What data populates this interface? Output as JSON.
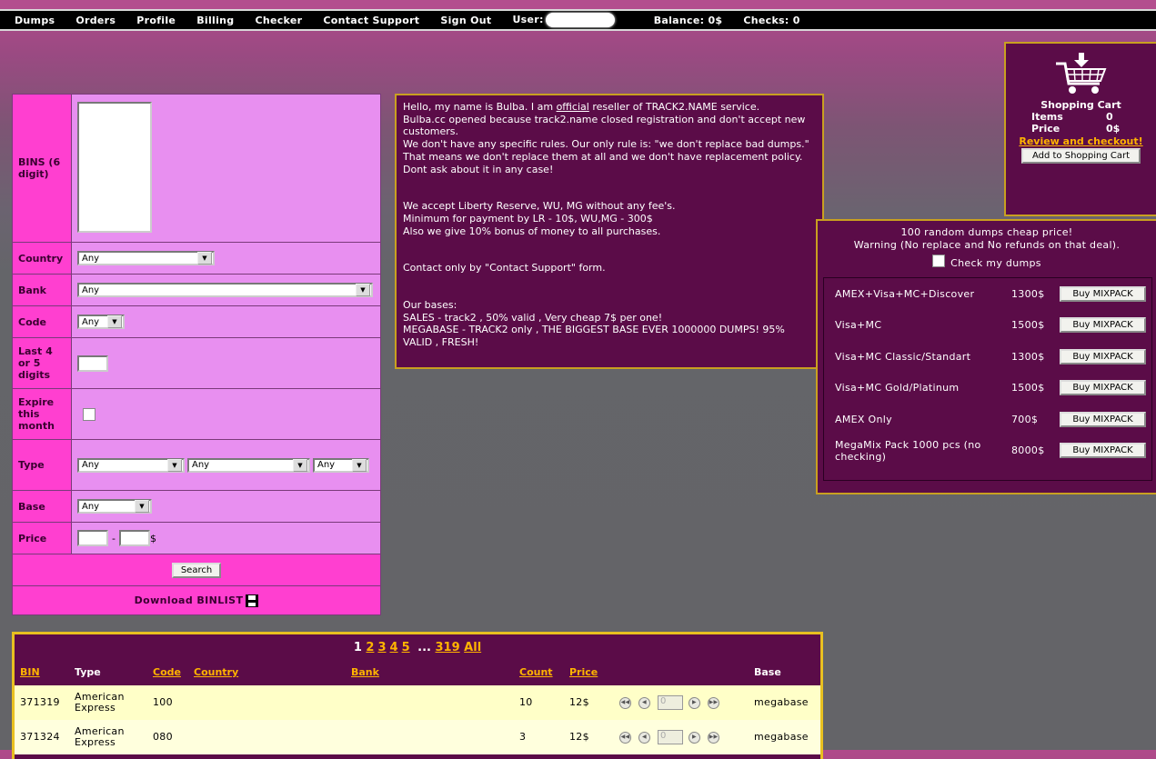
{
  "nav": {
    "dumps": "Dumps",
    "orders": "Orders",
    "profile": "Profile",
    "billing": "Billing",
    "checker": "Checker",
    "contact": "Contact Support",
    "signout": "Sign Out",
    "user_label": "User:",
    "balance": "Balance: 0$",
    "checks": "Checks: 0"
  },
  "search": {
    "bins_label": "BINS (6 digit)",
    "country_label": "Country",
    "country_value": "Any",
    "bank_label": "Bank",
    "bank_value": "Any",
    "code_label": "Code",
    "code_value": "Any",
    "last4_label": "Last 4 or 5 digits",
    "expire_label": "Expire this month",
    "type_label": "Type",
    "type_value1": "Any",
    "type_value2": "Any",
    "type_value3": "Any",
    "base_label": "Base",
    "base_value": "Any",
    "price_label": "Price",
    "price_sep": "-",
    "price_unit": "$",
    "search_button": "Search",
    "download": "Download BINLIST"
  },
  "info": {
    "p1_pre": "Hello, my name is Bulba. I am ",
    "p1_official": "official",
    "p1_post": " reseller of TRACK2.NAME service.\nBulba.cc opened because track2.name closed registration and don't accept new customers.\nWe don't have any specific rules. Our only rule is: \"we don't replace bad dumps.\"\nThat means we don't replace them at all and we don't have replacement policy. Dont ask about it in any case!",
    "p2": "We accept Liberty Reserve, WU, MG without any fee's.\nMinimum for payment by LR - 10$, WU,MG - 300$\nAlso we give 10% bonus of money to all purchases.",
    "p3": "Contact only by \"Contact Support\" form.",
    "p4": "Our bases:\nSALES - track2 , 50% valid , Very cheap 7$ per one!\nMEGABASE - TRACK2 only , THE BIGGEST BASE EVER 1000000 DUMPS! 95% VALID , FRESH!"
  },
  "cart": {
    "title": "Shopping Cart",
    "items_label": "Items",
    "items_value": "0",
    "price_label": "Price",
    "price_value": "0$",
    "review_link": "Review and checkout!",
    "add_button": "Add to Shopping Cart"
  },
  "mix": {
    "headline": "100 random dumps cheap price!",
    "warning": "Warning (No replace and No refunds on that deal).",
    "check_label": "Check my dumps",
    "buy_label": "Buy MIXPACK",
    "packs": [
      {
        "name": "AMEX+Visa+MC+Discover",
        "price": "1300$"
      },
      {
        "name": "Visa+MC",
        "price": "1500$"
      },
      {
        "name": "Visa+MC Classic/Standart",
        "price": "1300$"
      },
      {
        "name": "Visa+MC Gold/Platinum",
        "price": "1500$"
      },
      {
        "name": "AMEX Only",
        "price": "700$"
      },
      {
        "name": "MegaMix Pack 1000 pcs (no checking)",
        "price": "8000$"
      }
    ]
  },
  "results": {
    "page_current": "1",
    "pages": [
      "2",
      "3",
      "4",
      "5"
    ],
    "ellipsis": "...",
    "page_last": "319",
    "page_all": "All",
    "headers": {
      "bin": "BIN",
      "type": "Type",
      "code": "Code",
      "country": "Country",
      "bank": "Bank",
      "count": "Count",
      "price": "Price",
      "base": "Base"
    },
    "qty_placeholder": "0",
    "rows": [
      {
        "bin": "371319",
        "type": "American Express",
        "code": "100",
        "country": "",
        "bank": "",
        "count": "10",
        "price": "12$",
        "base": "megabase"
      },
      {
        "bin": "371324",
        "type": "American Express",
        "code": "080",
        "country": "",
        "bank": "",
        "count": "3",
        "price": "12$",
        "base": "megabase"
      }
    ]
  }
}
